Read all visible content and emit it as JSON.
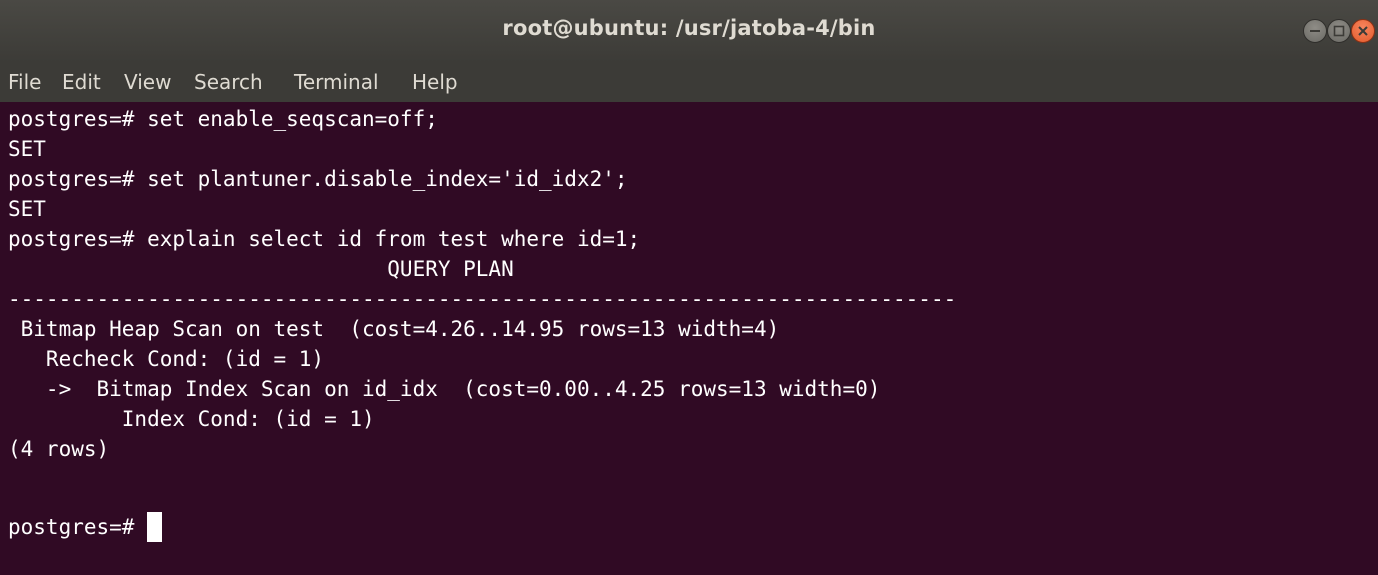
{
  "window": {
    "title": "root@ubuntu: /usr/jatoba-4/bin",
    "controls": {
      "minimize_icon": "minimize-icon",
      "maximize_icon": "maximize-icon",
      "close_icon": "close-icon",
      "close_color": "#e95420"
    }
  },
  "menubar": {
    "items": [
      {
        "label": "File"
      },
      {
        "label": "Edit"
      },
      {
        "label": "View"
      },
      {
        "label": "Search"
      },
      {
        "label": "Terminal"
      },
      {
        "label": "Help"
      }
    ]
  },
  "terminal": {
    "background": "#300a24",
    "foreground": "#ffffff",
    "lines": [
      "postgres=# set enable_seqscan=off;",
      "SET",
      "postgres=# set plantuner.disable_index='id_idx2';",
      "SET",
      "postgres=# explain select id from test where id=1;",
      "                              QUERY PLAN",
      "---------------------------------------------------------------------------",
      " Bitmap Heap Scan on test  (cost=4.26..14.95 rows=13 width=4)",
      "   Recheck Cond: (id = 1)",
      "   ->  Bitmap Index Scan on id_idx  (cost=0.00..4.25 rows=13 width=0)",
      "         Index Cond: (id = 1)",
      "(4 rows)",
      "",
      "postgres=# "
    ]
  }
}
